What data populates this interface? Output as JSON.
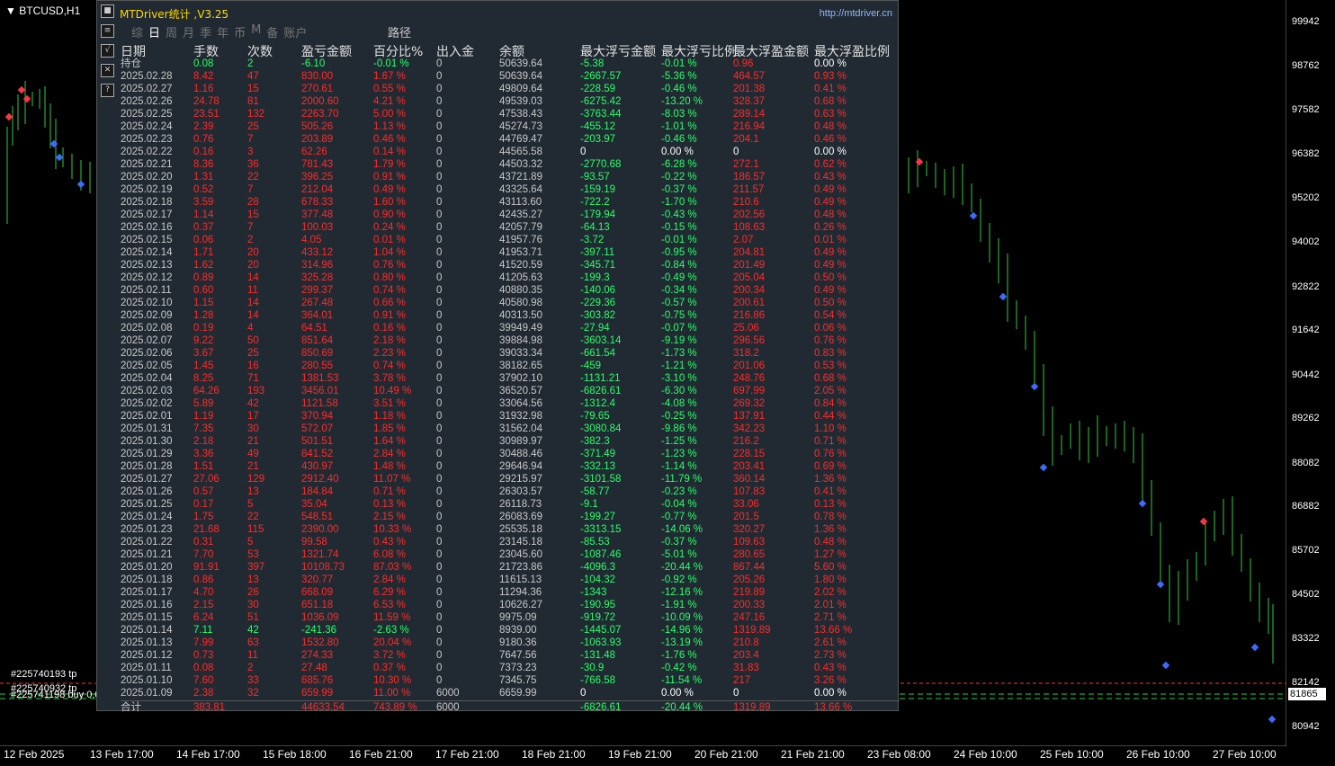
{
  "chart": {
    "symbol": "BTCUSD,H1",
    "price_ticks": [
      "99942",
      "98762",
      "97582",
      "96382",
      "95202",
      "94002",
      "92822",
      "91642",
      "90442",
      "89262",
      "88082",
      "86882",
      "85702",
      "84502",
      "83322",
      "82142",
      "80942"
    ],
    "current_price": "81865",
    "time_ticks": [
      "12 Feb 2025",
      "13 Feb 17:00",
      "14 Feb 17:00",
      "15 Feb 18:00",
      "16 Feb 21:00",
      "17 Feb 21:00",
      "18 Feb 21:00",
      "19 Feb 21:00",
      "20 Feb 21:00",
      "21 Feb 21:00",
      "23 Feb 08:00",
      "24 Feb 10:00",
      "25 Feb 10:00",
      "26 Feb 10:00",
      "27 Feb 10:00"
    ],
    "order_labels": [
      "#225740193 tp",
      "#225740932 tp",
      "#225741198 buy 0.0"
    ],
    "colors": {
      "candle": "#2ecc40",
      "grid": "#3a3a3a",
      "line_red": "#ff3333",
      "line_green": "#2ecc40"
    }
  },
  "panel": {
    "title": "MTDriver统计 ,V3.25",
    "url": "http://mtdriver.cn",
    "side_buttons": [
      "■",
      "≡",
      "√",
      "✕",
      "?"
    ],
    "tabs": [
      "综",
      "日",
      "周",
      "月",
      "季",
      "年",
      "币",
      "M",
      "备",
      "账户"
    ],
    "path_label": "路径",
    "headers": [
      "日期",
      "手数",
      "次数",
      "盈亏金额",
      "百分比%",
      "出入金",
      "余额",
      "最大浮亏金额",
      "最大浮亏比例",
      "最大浮盈金额",
      "最大浮盈比例"
    ],
    "rows": [
      [
        "持仓",
        "0.08",
        "2",
        "-6.10",
        "-0.01 %",
        "0",
        "50639.64",
        "-5.38",
        "-0.01 %",
        "0.96",
        "0.00 %"
      ],
      [
        "2025.02.28",
        "8.42",
        "47",
        "830.00",
        "1.67 %",
        "0",
        "50639.64",
        "-2667.57",
        "-5.36 %",
        "464.57",
        "0.93 %"
      ],
      [
        "2025.02.27",
        "1.16",
        "15",
        "270.61",
        "0.55 %",
        "0",
        "49809.64",
        "-228.59",
        "-0.46 %",
        "201.38",
        "0.41 %"
      ],
      [
        "2025.02.26",
        "24.78",
        "81",
        "2000.60",
        "4.21 %",
        "0",
        "49539.03",
        "-6275.42",
        "-13.20 %",
        "328.37",
        "0.68 %"
      ],
      [
        "2025.02.25",
        "23.51",
        "132",
        "2263.70",
        "5.00 %",
        "0",
        "47538.43",
        "-3763.44",
        "-8.03 %",
        "289.14",
        "0.63 %"
      ],
      [
        "2025.02.24",
        "2.39",
        "25",
        "505.26",
        "1.13 %",
        "0",
        "45274.73",
        "-455.12",
        "-1.01 %",
        "216.94",
        "0.48 %"
      ],
      [
        "2025.02.23",
        "0.76",
        "7",
        "203.89",
        "0.46 %",
        "0",
        "44769.47",
        "-203.97",
        "-0.46 %",
        "204.1",
        "0.46 %"
      ],
      [
        "2025.02.22",
        "0.16",
        "3",
        "62.26",
        "0.14 %",
        "0",
        "44565.58",
        "0",
        "0.00 %",
        "0",
        "0.00 %"
      ],
      [
        "2025.02.21",
        "8.36",
        "36",
        "781.43",
        "1.79 %",
        "0",
        "44503.32",
        "-2770.68",
        "-6.28 %",
        "272.1",
        "0.62 %"
      ],
      [
        "2025.02.20",
        "1.31",
        "22",
        "396.25",
        "0.91 %",
        "0",
        "43721.89",
        "-93.57",
        "-0.22 %",
        "186.57",
        "0.43 %"
      ],
      [
        "2025.02.19",
        "0.52",
        "7",
        "212.04",
        "0.49 %",
        "0",
        "43325.64",
        "-159.19",
        "-0.37 %",
        "211.57",
        "0.49 %"
      ],
      [
        "2025.02.18",
        "3.59",
        "28",
        "678.33",
        "1.60 %",
        "0",
        "43113.60",
        "-722.2",
        "-1.70 %",
        "210.6",
        "0.49 %"
      ],
      [
        "2025.02.17",
        "1.14",
        "15",
        "377.48",
        "0.90 %",
        "0",
        "42435.27",
        "-179.94",
        "-0.43 %",
        "202.56",
        "0.48 %"
      ],
      [
        "2025.02.16",
        "0.37",
        "7",
        "100.03",
        "0.24 %",
        "0",
        "42057.79",
        "-64.13",
        "-0.15 %",
        "108.63",
        "0.26 %"
      ],
      [
        "2025.02.15",
        "0.06",
        "2",
        "4.05",
        "0.01 %",
        "0",
        "41957.76",
        "-3.72",
        "-0.01 %",
        "2.07",
        "0.01 %"
      ],
      [
        "2025.02.14",
        "1.71",
        "20",
        "433.12",
        "1.04 %",
        "0",
        "41953.71",
        "-397.11",
        "-0.95 %",
        "204.81",
        "0.49 %"
      ],
      [
        "2025.02.13",
        "1.62",
        "20",
        "314.96",
        "0.76 %",
        "0",
        "41520.59",
        "-345.71",
        "-0.84 %",
        "201.49",
        "0.49 %"
      ],
      [
        "2025.02.12",
        "0.89",
        "14",
        "325.28",
        "0.80 %",
        "0",
        "41205.63",
        "-199.3",
        "-0.49 %",
        "205.04",
        "0.50 %"
      ],
      [
        "2025.02.11",
        "0.60",
        "11",
        "299.37",
        "0.74 %",
        "0",
        "40880.35",
        "-140.06",
        "-0.34 %",
        "200.34",
        "0.49 %"
      ],
      [
        "2025.02.10",
        "1.15",
        "14",
        "267.48",
        "0.66 %",
        "0",
        "40580.98",
        "-229.36",
        "-0.57 %",
        "200.61",
        "0.50 %"
      ],
      [
        "2025.02.09",
        "1.28",
        "14",
        "364.01",
        "0.91 %",
        "0",
        "40313.50",
        "-303.82",
        "-0.75 %",
        "216.86",
        "0.54 %"
      ],
      [
        "2025.02.08",
        "0.19",
        "4",
        "64.51",
        "0.16 %",
        "0",
        "39949.49",
        "-27.94",
        "-0.07 %",
        "25.06",
        "0.06 %"
      ],
      [
        "2025.02.07",
        "9.22",
        "50",
        "851.64",
        "2.18 %",
        "0",
        "39884.98",
        "-3603.14",
        "-9.19 %",
        "296.56",
        "0.76 %"
      ],
      [
        "2025.02.06",
        "3.67",
        "25",
        "850.69",
        "2.23 %",
        "0",
        "39033.34",
        "-661.54",
        "-1.73 %",
        "318.2",
        "0.83 %"
      ],
      [
        "2025.02.05",
        "1.45",
        "16",
        "280.55",
        "0.74 %",
        "0",
        "38182.65",
        "-459",
        "-1.21 %",
        "201.06",
        "0.53 %"
      ],
      [
        "2025.02.04",
        "8.25",
        "71",
        "1381.53",
        "3.78 %",
        "0",
        "37902.10",
        "-1131.21",
        "-3.10 %",
        "248.76",
        "0.68 %"
      ],
      [
        "2025.02.03",
        "64.26",
        "193",
        "3456.01",
        "10.49 %",
        "0",
        "36520.57",
        "-6826.61",
        "-6.30 %",
        "697.99",
        "2.05 %"
      ],
      [
        "2025.02.02",
        "5.89",
        "42",
        "1121.58",
        "3.51 %",
        "0",
        "33064.56",
        "-1312.4",
        "-4.08 %",
        "269.32",
        "0.84 %"
      ],
      [
        "2025.02.01",
        "1.19",
        "17",
        "370.94",
        "1.18 %",
        "0",
        "31932.98",
        "-79.65",
        "-0.25 %",
        "137.91",
        "0.44 %"
      ],
      [
        "2025.01.31",
        "7.35",
        "30",
        "572.07",
        "1.85 %",
        "0",
        "31562.04",
        "-3080.84",
        "-9.86 %",
        "342.23",
        "1.10 %"
      ],
      [
        "2025.01.30",
        "2.18",
        "21",
        "501.51",
        "1.64 %",
        "0",
        "30989.97",
        "-382.3",
        "-1.25 %",
        "216.2",
        "0.71 %"
      ],
      [
        "2025.01.29",
        "3.36",
        "49",
        "841.52",
        "2.84 %",
        "0",
        "30488.46",
        "-371.49",
        "-1.23 %",
        "228.15",
        "0.76 %"
      ],
      [
        "2025.01.28",
        "1.51",
        "21",
        "430.97",
        "1.48 %",
        "0",
        "29646.94",
        "-332.13",
        "-1.14 %",
        "203.41",
        "0.69 %"
      ],
      [
        "2025.01.27",
        "27.06",
        "129",
        "2912.40",
        "11.07 %",
        "0",
        "29215.97",
        "-3101.58",
        "-11.79 %",
        "360.14",
        "1.36 %"
      ],
      [
        "2025.01.26",
        "0.57",
        "13",
        "184.84",
        "0.71 %",
        "0",
        "26303.57",
        "-58.77",
        "-0.23 %",
        "107.83",
        "0.41 %"
      ],
      [
        "2025.01.25",
        "0.17",
        "5",
        "35.04",
        "0.13 %",
        "0",
        "26118.73",
        "-9.1",
        "-0.04 %",
        "33.06",
        "0.13 %"
      ],
      [
        "2025.01.24",
        "1.75",
        "22",
        "548.51",
        "2.15 %",
        "0",
        "26083.69",
        "-199.27",
        "-0.77 %",
        "201.5",
        "0.78 %"
      ],
      [
        "2025.01.23",
        "21.68",
        "115",
        "2390.00",
        "10.33 %",
        "0",
        "25535.18",
        "-3313.15",
        "-14.06 %",
        "320.27",
        "1.36 %"
      ],
      [
        "2025.01.22",
        "0.31",
        "5",
        "99.58",
        "0.43 %",
        "0",
        "23145.18",
        "-85.53",
        "-0.37 %",
        "109.63",
        "0.48 %"
      ],
      [
        "2025.01.21",
        "7.70",
        "53",
        "1321.74",
        "6.08 %",
        "0",
        "23045.60",
        "-1087.46",
        "-5.01 %",
        "280.65",
        "1.27 %"
      ],
      [
        "2025.01.20",
        "91.91",
        "397",
        "10108.73",
        "87.03 %",
        "0",
        "21723.86",
        "-4096.3",
        "-20.44 %",
        "867.44",
        "5.60 %"
      ],
      [
        "2025.01.18",
        "0.86",
        "13",
        "320.77",
        "2.84 %",
        "0",
        "11615.13",
        "-104.32",
        "-0.92 %",
        "205.26",
        "1.80 %"
      ],
      [
        "2025.01.17",
        "4.70",
        "26",
        "668.09",
        "6.29 %",
        "0",
        "11294.36",
        "-1343",
        "-12.16 %",
        "219.89",
        "2.02 %"
      ],
      [
        "2025.01.16",
        "2.15",
        "30",
        "651.18",
        "6.53 %",
        "0",
        "10626.27",
        "-190.95",
        "-1.91 %",
        "200.33",
        "2.01 %"
      ],
      [
        "2025.01.15",
        "6.24",
        "51",
        "1036.09",
        "11.59 %",
        "0",
        "9975.09",
        "-919.72",
        "-10.09 %",
        "247.16",
        "2.71 %"
      ],
      [
        "2025.01.14",
        "7.11",
        "42",
        "-241.36",
        "-2.63 %",
        "0",
        "8939.00",
        "-1445.07",
        "-14.96 %",
        "1319.89",
        "13.66 %"
      ],
      [
        "2025.01.13",
        "7.99",
        "63",
        "1532.80",
        "20.04 %",
        "0",
        "9180.36",
        "-1063.93",
        "-13.19 %",
        "210.8",
        "2.61 %"
      ],
      [
        "2025.01.12",
        "0.73",
        "11",
        "274.33",
        "3.72 %",
        "0",
        "7647.56",
        "-131.48",
        "-1.76 %",
        "203.4",
        "2.73 %"
      ],
      [
        "2025.01.11",
        "0.08",
        "2",
        "27.48",
        "0.37 %",
        "0",
        "7373.23",
        "-30.9",
        "-0.42 %",
        "31.83",
        "0.43 %"
      ],
      [
        "2025.01.10",
        "7.60",
        "33",
        "685.76",
        "10.30 %",
        "0",
        "7345.75",
        "-766.58",
        "-11.54 %",
        "217",
        "3.26 %"
      ],
      [
        "2025.01.09",
        "2.38",
        "32",
        "659.99",
        "11.00 %",
        "6000",
        "6659.99",
        "0",
        "0.00 %",
        "0",
        "0.00 %"
      ]
    ],
    "total": [
      "合计",
      "383.81",
      "",
      "44633.54",
      "743.89 %",
      "6000",
      "",
      "-6826.61",
      "-20.44 %",
      "1319.89",
      "13.66 %"
    ]
  }
}
